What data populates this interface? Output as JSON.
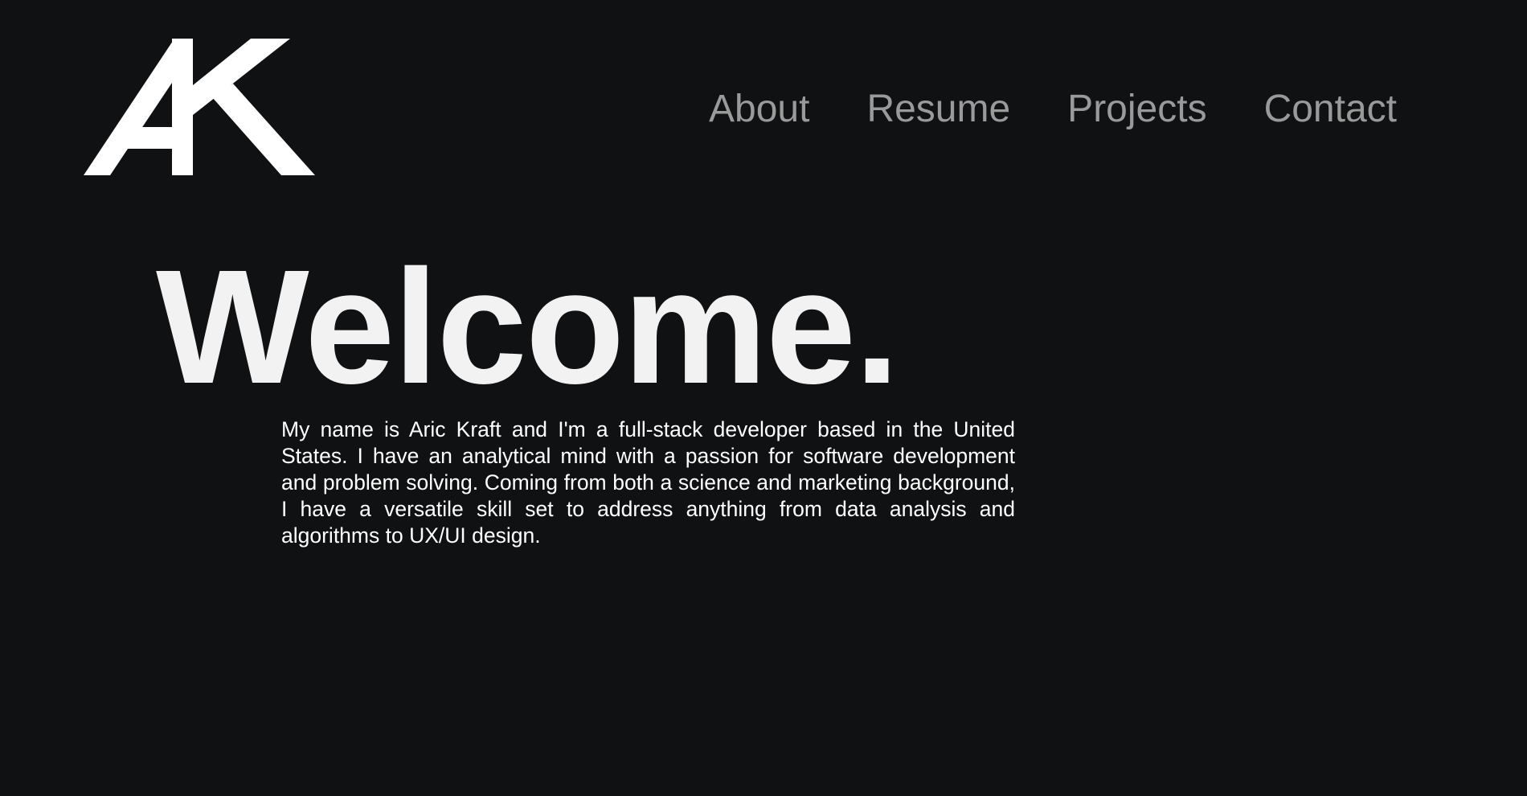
{
  "logo": {
    "text": "AK",
    "color": "#ffffff"
  },
  "nav": {
    "items": [
      {
        "label": "About"
      },
      {
        "label": "Resume"
      },
      {
        "label": "Projects"
      },
      {
        "label": "Contact"
      }
    ],
    "color": "#9a9a9a"
  },
  "hero": {
    "title": "Welcome.",
    "intro": "My name is Aric Kraft and I'm a full-stack developer based in the United States. I have an analytical mind with a passion for software development and problem solving. Coming from both a science and marketing background, I have a versatile skill set to address anything from data analysis and algorithms to UX/UI design."
  },
  "colors": {
    "background": "#0f1113",
    "title": "#f2f2f2",
    "body_text": "#ffffff"
  }
}
